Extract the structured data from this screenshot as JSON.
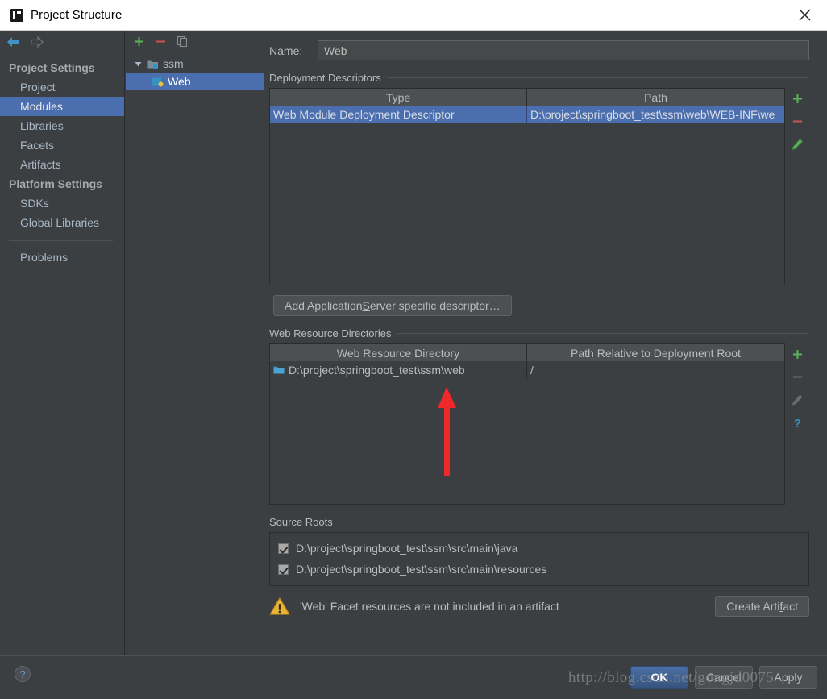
{
  "window": {
    "title": "Project Structure",
    "logo_icon": "intellij-idea-logo",
    "close_icon": "close-icon"
  },
  "sidebar": {
    "back_icon": "back-arrow-icon",
    "forward_icon": "forward-arrow-icon",
    "groups": [
      {
        "label": "Project Settings",
        "items": [
          {
            "label": "Project",
            "selected": false
          },
          {
            "label": "Modules",
            "selected": true
          },
          {
            "label": "Libraries",
            "selected": false
          },
          {
            "label": "Facets",
            "selected": false
          },
          {
            "label": "Artifacts",
            "selected": false
          }
        ]
      },
      {
        "label": "Platform Settings",
        "items": [
          {
            "label": "SDKs",
            "selected": false
          },
          {
            "label": "Global Libraries",
            "selected": false
          }
        ]
      }
    ],
    "problems": {
      "label": "Problems"
    }
  },
  "tree": {
    "toolbar": {
      "add_icon": "plus-icon",
      "remove_icon": "minus-icon",
      "copy_icon": "copy-icon"
    },
    "nodes": [
      {
        "label": "ssm",
        "icon": "module-folder-icon",
        "expanded": true,
        "selected": false
      },
      {
        "label": "Web",
        "icon": "web-facet-icon",
        "selected": true
      }
    ]
  },
  "main": {
    "name": {
      "label_before": "Na",
      "label_mnemonic": "m",
      "label_after": "e:",
      "value": "Web"
    },
    "deployment_descriptors": {
      "title": "Deployment Descriptors",
      "columns": [
        "Type",
        "Path"
      ],
      "rows": [
        {
          "type": "Web Module Deployment Descriptor",
          "path": "D:\\project\\springboot_test\\ssm\\web\\WEB-INF\\we",
          "selected": true
        }
      ],
      "buttons": {
        "add_icon": "plus-icon",
        "remove_icon": "minus-icon",
        "edit_icon": "pencil-icon"
      },
      "add_descriptor_button": {
        "text_before": "Add Application ",
        "mnemonic": "S",
        "text_after": "erver specific descriptor…"
      }
    },
    "web_resource_directories": {
      "title": "Web Resource Directories",
      "columns": [
        "Web Resource Directory",
        "Path Relative to Deployment Root"
      ],
      "rows": [
        {
          "directory": "D:\\project\\springboot_test\\ssm\\web",
          "relative_path": "/",
          "icon": "folder-icon"
        }
      ],
      "buttons": {
        "add_icon": "plus-icon",
        "remove_icon": "minus-icon",
        "edit_icon": "pencil-icon",
        "help_icon": "question-icon"
      }
    },
    "source_roots": {
      "title": "Source Roots",
      "items": [
        {
          "label": "D:\\project\\springboot_test\\ssm\\src\\main\\java",
          "checked": true
        },
        {
          "label": "D:\\project\\springboot_test\\ssm\\src\\main\\resources",
          "checked": true
        }
      ]
    },
    "warning": {
      "icon": "warning-triangle-icon",
      "message": "'Web' Facet resources are not included in an artifact",
      "action_before": "Create Arti",
      "action_mnemonic": "f",
      "action_after": "act"
    }
  },
  "footer": {
    "help_label": "?",
    "ok_label": "OK",
    "cancel_label": "Cancel",
    "apply_label": "Apply"
  },
  "annotation": {
    "arrow_icon": "red-up-arrow-annotation",
    "color": "#ef2929"
  },
  "watermark": {
    "text": "http://blog.csdn.net/gongjd0075"
  },
  "colors": {
    "background": "#3c3f41",
    "selection": "#4b6eaf",
    "text": "#bbbbbb",
    "titlebar": "#ffffff",
    "accent_green": "#5ab55a",
    "accent_red": "#c75450",
    "warning": "#e8b339"
  }
}
